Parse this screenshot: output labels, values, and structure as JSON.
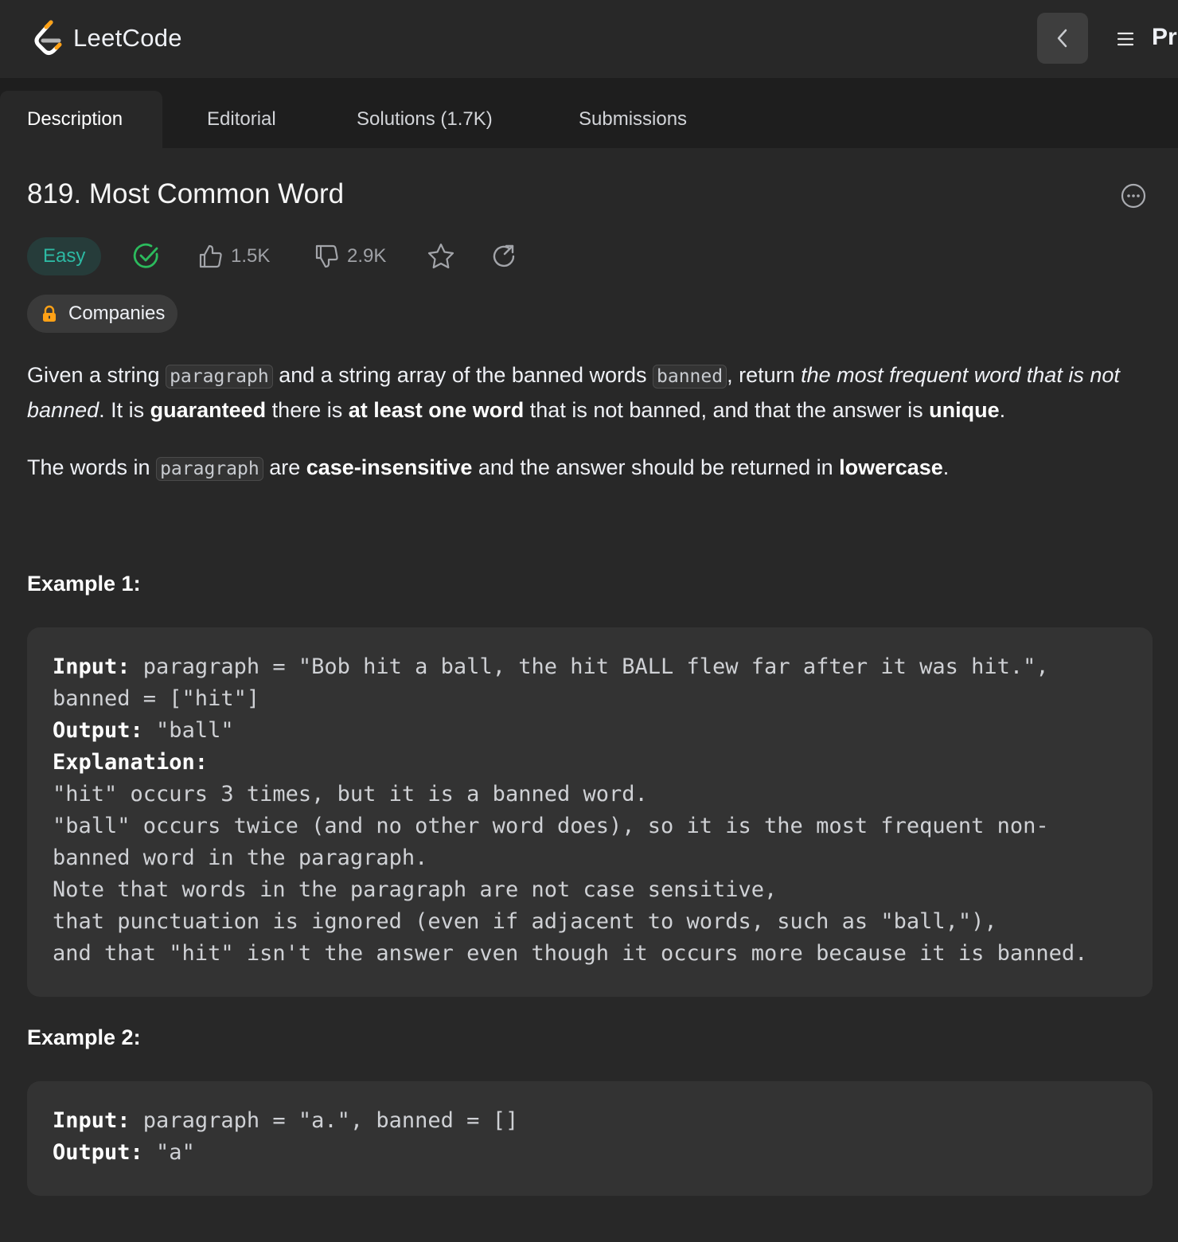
{
  "header": {
    "logo_text": "LeetCode",
    "menu_label": "Pr"
  },
  "tabs": [
    {
      "label": "Description"
    },
    {
      "label": "Editorial"
    },
    {
      "label": "Solutions (1.7K)"
    },
    {
      "label": "Submissions"
    }
  ],
  "problem": {
    "title": "819. Most Common Word",
    "difficulty": "Easy",
    "likes": "1.5K",
    "dislikes": "2.9K",
    "companies_label": "Companies"
  },
  "description": {
    "p1": {
      "t1": "Given a string ",
      "code1": "paragraph",
      "t2": " and a string array of the banned words ",
      "code2": "banned",
      "t3": ", return ",
      "em1": "the most frequent word that is not banned",
      "t4": ". It is ",
      "b1": "guaranteed",
      "t5": " there is ",
      "b2": "at least one word",
      "t6": " that is not banned, and that the answer is ",
      "b3": "unique",
      "t7": "."
    },
    "p2": {
      "t1": "The words in ",
      "code1": "paragraph",
      "t2": " are ",
      "b1": "case-insensitive",
      "t3": " and the answer should be returned in ",
      "b2": "lowercase",
      "t4": "."
    }
  },
  "examples": [
    {
      "title": "Example 1:",
      "input_label": "Input:",
      "input_line1": " paragraph = \"Bob hit a ball, the hit BALL flew far after it was hit.\",",
      "input_line2": "banned = [\"hit\"]",
      "output_label": "Output:",
      "output_value": " \"ball\"",
      "explanation_label": "Explanation:",
      "explanation_lines": [
        "\"hit\" occurs 3 times, but it is a banned word.",
        "\"ball\" occurs twice (and no other word does), so it is the most frequent non-",
        "banned word in the paragraph.",
        "Note that words in the paragraph are not case sensitive,",
        "that punctuation is ignored (even if adjacent to words, such as \"ball,\"),",
        "and that \"hit\" isn't the answer even though it occurs more because it is banned."
      ]
    },
    {
      "title": "Example 2:",
      "input_label": "Input:",
      "input_line1": " paragraph = \"a.\", banned = []",
      "output_label": "Output:",
      "output_value": " \"a\""
    }
  ],
  "colors": {
    "background": "#282828",
    "tabbar": "#1e1e1e",
    "easy": "#2db9a3",
    "solved_check": "#2cbb5d",
    "lock": "#ffa116"
  },
  "icons": [
    "leetcode-logo-icon",
    "chevron-left-icon",
    "hamburger-menu-icon",
    "more-options-icon",
    "solved-check-icon",
    "thumbs-up-icon",
    "thumbs-down-icon",
    "star-icon",
    "share-icon",
    "lock-icon"
  ]
}
